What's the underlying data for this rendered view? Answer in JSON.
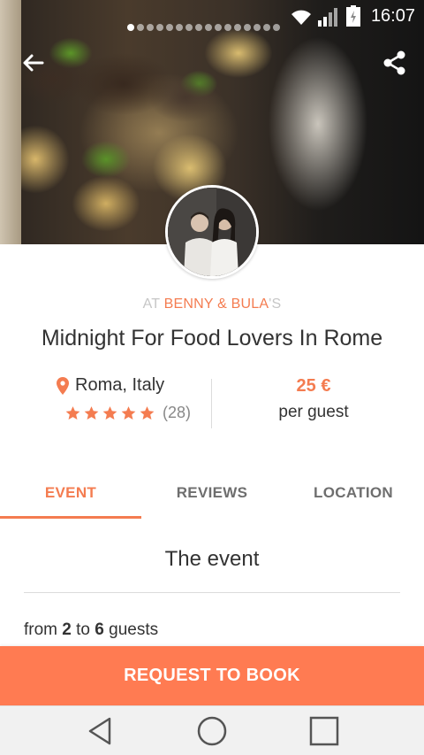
{
  "status_bar": {
    "time": "16:07",
    "icons": [
      "wifi-icon",
      "signal-icon",
      "battery-icon"
    ]
  },
  "hero": {
    "page_count": 16,
    "active_page": 1,
    "back_icon": "arrow-left-icon",
    "share_icon": "share-icon"
  },
  "host": {
    "prefix": "AT ",
    "name": "BENNY & BULA",
    "suffix": "'S"
  },
  "event": {
    "title": "Midnight For Food Lovers In Rome",
    "location": "Roma, Italy",
    "rating_stars": 5,
    "rating_count": "(28)",
    "price": "25 €",
    "price_unit": "per guest"
  },
  "tabs": [
    {
      "label": "EVENT",
      "active": true
    },
    {
      "label": "REVIEWS",
      "active": false
    },
    {
      "label": "LOCATION",
      "active": false
    }
  ],
  "section": {
    "title": "The event",
    "guests_from_label": "from ",
    "guests_min": "2",
    "guests_to_label": " to ",
    "guests_max": "6",
    "guests_suffix": " guests"
  },
  "book_button": "REQUEST TO BOOK",
  "colors": {
    "accent": "#f47c50",
    "button": "#ff7b52",
    "star": "#f47c50"
  },
  "navigation_bar": [
    "back-triangle-icon",
    "home-circle-icon",
    "recents-square-icon"
  ]
}
